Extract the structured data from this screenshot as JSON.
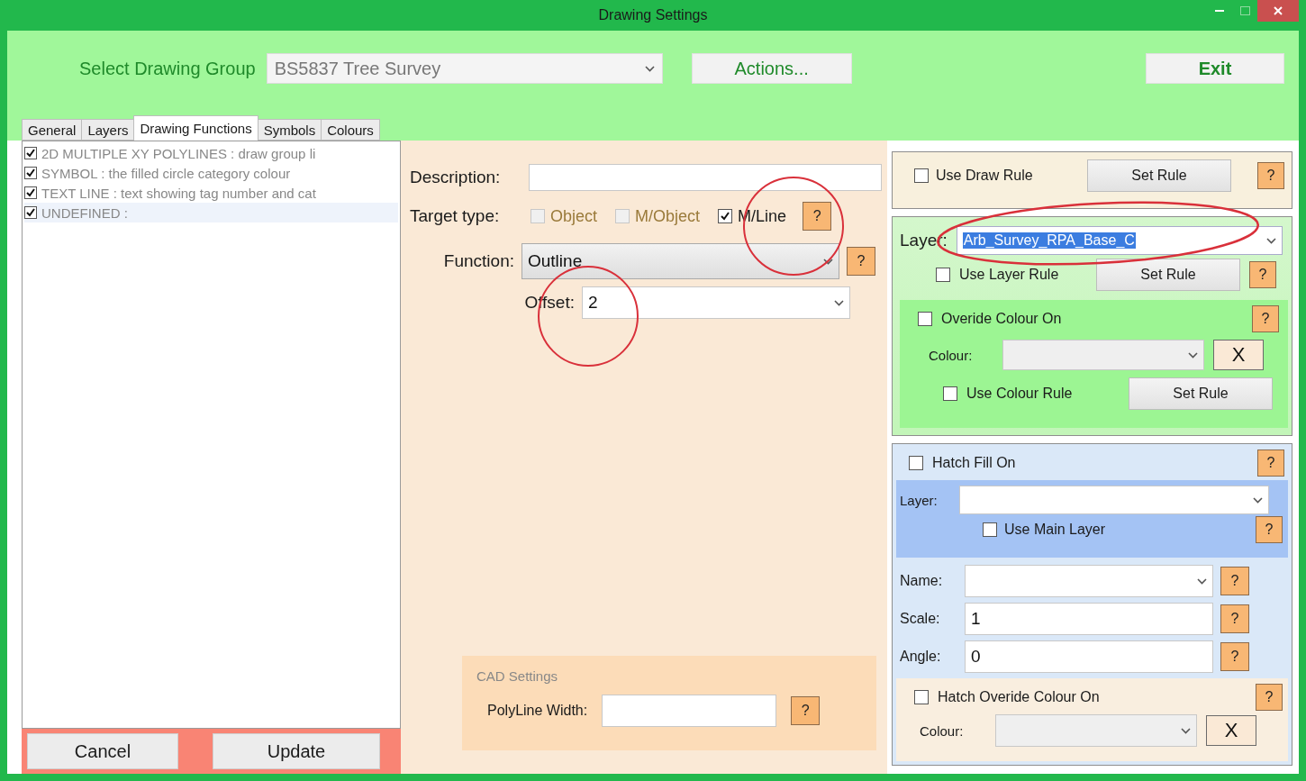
{
  "window": {
    "title": "Drawing Settings"
  },
  "header": {
    "group_label": "Select Drawing Group",
    "group_value": "BS5837 Tree Survey",
    "actions": "Actions...",
    "exit": "Exit"
  },
  "tabs": [
    {
      "label": "General",
      "selected": false
    },
    {
      "label": "Layers",
      "selected": false
    },
    {
      "label": "Drawing Functions",
      "selected": true
    },
    {
      "label": "Symbols",
      "selected": false
    },
    {
      "label": "Colours",
      "selected": false
    }
  ],
  "functions": [
    {
      "text": "2D MULTIPLE XY POLYLINES :  draw group li",
      "checked": true,
      "selected": false
    },
    {
      "text": "SYMBOL :  the filled circle category colour",
      "checked": true,
      "selected": false
    },
    {
      "text": "TEXT LINE :  text showing tag number and cat",
      "checked": true,
      "selected": false
    },
    {
      "text": "UNDEFINED :",
      "checked": true,
      "selected": true
    }
  ],
  "footer": {
    "cancel": "Cancel",
    "update": "Update"
  },
  "details": {
    "description_label": "Description:",
    "target_label": "Target type:",
    "targets": [
      {
        "label": "Object",
        "checked": false,
        "disabled": true
      },
      {
        "label": "M/Object",
        "checked": false,
        "disabled": true
      },
      {
        "label": "M/Line",
        "checked": true,
        "disabled": false
      }
    ],
    "target_help": "?",
    "function_label": "Function:",
    "function_value": "Outline",
    "function_help": "?",
    "offset_label": "Offset:",
    "offset_value": "2",
    "cad": {
      "title": "CAD Settings",
      "width_label": "PolyLine Width:",
      "help": "?"
    }
  },
  "draw_rule": {
    "label": "Use Draw Rule",
    "checked": false,
    "button": "Set Rule",
    "help": "?"
  },
  "layer": {
    "label": "Layer:",
    "value": "Arb_Survey_RPA_Base_C",
    "rule_label": "Use Layer Rule",
    "rule_checked": false,
    "button": "Set Rule",
    "help": "?",
    "override": {
      "label": "Overide Colour On",
      "checked": false,
      "help": "?",
      "colour_label": "Colour:",
      "clear": "X",
      "rule_label": "Use Colour Rule",
      "rule_checked": false,
      "button": "Set Rule"
    }
  },
  "hatch": {
    "label": "Hatch Fill On",
    "checked": false,
    "help": "?",
    "layer_label": "Layer:",
    "main_label": "Use Main Layer",
    "main_checked": false,
    "main_help": "?",
    "fields": [
      {
        "label": "Name:",
        "kind": "select",
        "help": "?"
      },
      {
        "label": "Scale:",
        "kind": "text",
        "value": "1",
        "help": "?"
      },
      {
        "label": "Angle:",
        "kind": "text",
        "value": "0",
        "help": "?"
      }
    ],
    "override": {
      "label": "Hatch Overide Colour On",
      "checked": false,
      "help": "?",
      "colour_label": "Colour:",
      "clear": "X"
    }
  }
}
